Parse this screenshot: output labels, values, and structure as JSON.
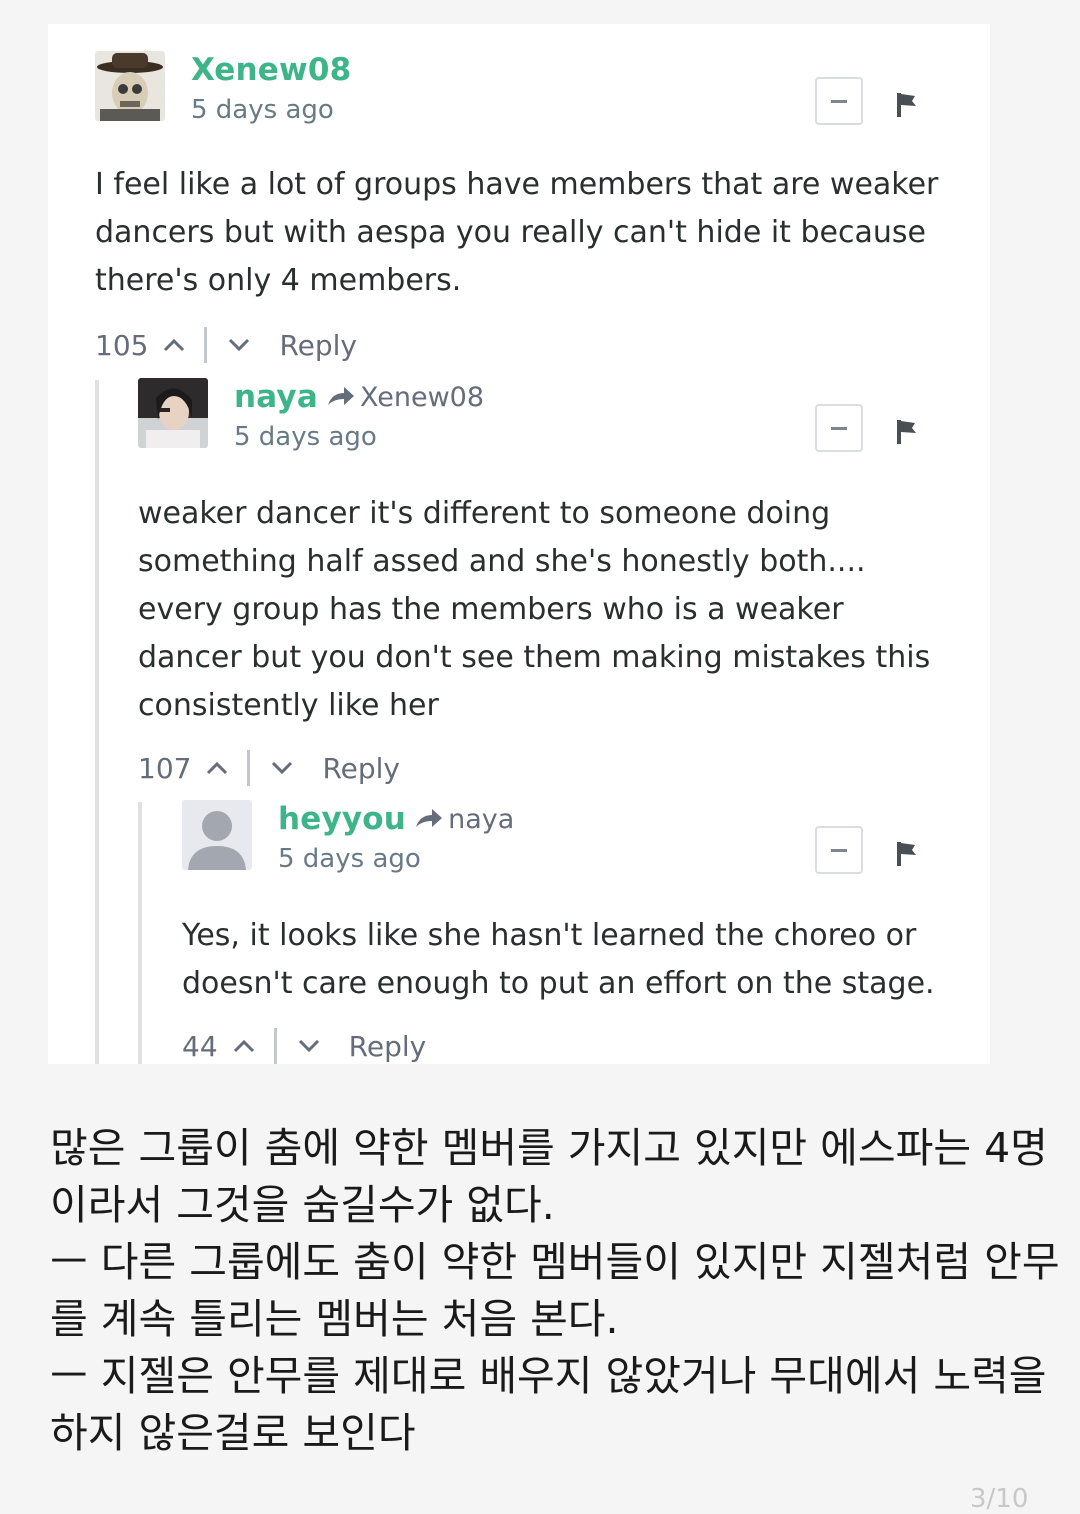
{
  "comments": [
    {
      "author": "Xenew08",
      "reply_to": "",
      "time": "5 days ago",
      "lines": [
        "I feel like a lot of groups have members that are weaker",
        "dancers but with aespa you really can't hide it because",
        "there's only 4 members."
      ],
      "votes": "105",
      "reply_label": "Reply",
      "avatar_icon": "cowboy-skull-avatar-icon"
    },
    {
      "author": "naya",
      "reply_to": "Xenew08",
      "time": "5 days ago",
      "lines": [
        "weaker dancer it's different to someone doing",
        "something half assed and she's honestly both....",
        "every group has the members who is a weaker",
        "dancer but you don't see them making mistakes this",
        "consistently like her"
      ],
      "votes": "107",
      "reply_label": "Reply",
      "avatar_icon": "photo-avatar-icon"
    },
    {
      "author": "heyyou",
      "reply_to": "naya",
      "time": "5 days ago",
      "lines": [
        "Yes, it looks like she hasn't learned the choreo or",
        "doesn't care enough to put an effort on the stage."
      ],
      "votes": "44",
      "reply_label": "Reply",
      "avatar_icon": "default-user-avatar-icon"
    }
  ],
  "translation": {
    "lines": [
      "많은 그룹이 춤에 약한 멤버를 가지고 있지만 에스파는 4명",
      "이라서 그것을 숨길수가 없다.",
      "ㅡ 다른 그룹에도 춤이 약한 멤버들이 있지만 지젤처럼 안무",
      "를 계속 틀리는 멤버는 처음 본다.",
      "ㅡ 지젤은 안무를 제대로 배우지 않았거나 무대에서 노력을",
      "하지 않은걸로 보인다"
    ]
  },
  "page_indicator": "3/10",
  "colors": {
    "author": "#3eb489",
    "meta": "#687a86",
    "text": "#2a2e2e",
    "thread_line": "#e1e1e1"
  }
}
